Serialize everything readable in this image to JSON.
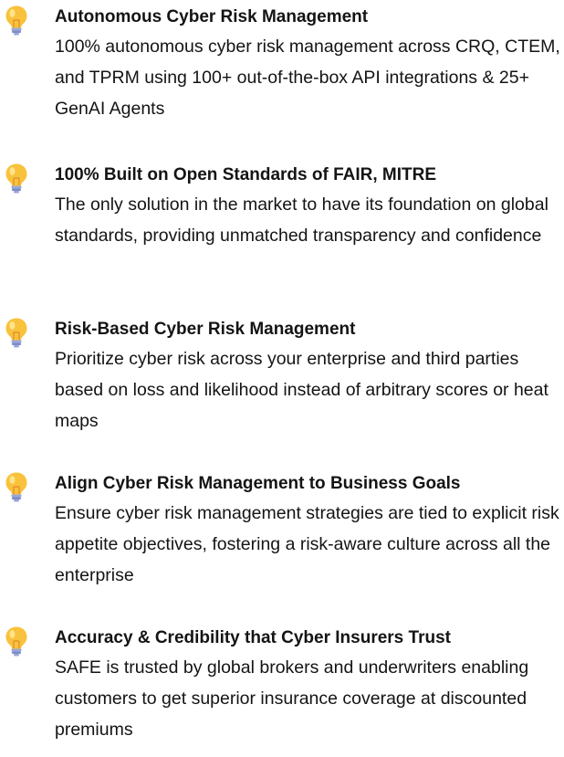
{
  "items": [
    {
      "icon": "lightbulb-icon",
      "title": "Autonomous Cyber Risk Management",
      "desc": "100% autonomous cyber risk management across CRQ, CTEM, and TPRM using 100+ out-of-the-box API integrations & 25+ GenAI Agents"
    },
    {
      "icon": "lightbulb-icon",
      "title": "100% Built on Open Standards of FAIR, MITRE",
      "desc": "The only solution in the market to have its foundation on global standards, providing unmatched transparency and confidence"
    },
    {
      "icon": "lightbulb-icon",
      "title": "Risk-Based Cyber Risk Management",
      "desc": "Prioritize cyber risk across your enterprise and third parties based on loss and likelihood instead of arbitrary scores or heat maps"
    },
    {
      "icon": "lightbulb-icon",
      "title": "Align Cyber Risk Management to Business Goals",
      "desc": "Ensure cyber risk management strategies are tied to explicit risk appetite objectives, fostering a risk-aware culture across all the enterprise"
    },
    {
      "icon": "lightbulb-icon",
      "title": "Accuracy & Credibility that Cyber Insurers Trust",
      "desc": "SAFE is trusted by global brokers and underwriters enabling customers to get superior insurance coverage at discounted premiums"
    }
  ],
  "colors": {
    "bulb": "#f9c23c",
    "bulb_glare": "#fde38a",
    "base": "#9aa7d8",
    "base_dark": "#7d8cc9",
    "text": "#141414"
  }
}
